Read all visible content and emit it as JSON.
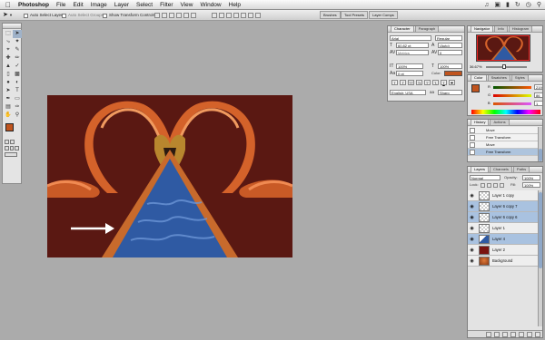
{
  "menubar": {
    "apple": "",
    "items": [
      "Photoshop",
      "File",
      "Edit",
      "Image",
      "Layer",
      "Select",
      "Filter",
      "View",
      "Window",
      "Help"
    ]
  },
  "options": {
    "auto_select_layer": "Auto Select Layer",
    "auto_select_groups": "Auto Select Groups",
    "show_transform_controls": "Show Transform Controls",
    "well_tabs": [
      "Brushes",
      "Tool Presets",
      "Layer Comps"
    ]
  },
  "character": {
    "tabs": [
      "Character",
      "Paragraph"
    ],
    "font_family": "Arial",
    "font_style": "Regular",
    "font_size": "60.82 pt",
    "leading": "(Auto)",
    "kerning": "Metrics",
    "tracking": "0",
    "vertical_scale": "100%",
    "horizontal_scale": "100%",
    "baseline_shift": "0 pt",
    "color_label": "Color:",
    "color_value": "#c0541e",
    "style_buttons": [
      "T",
      "T",
      "TT",
      "Tt",
      "T'",
      "T,",
      "T",
      "T"
    ],
    "language": "English: USA",
    "antialias_label": "aa",
    "antialias": "Sharp"
  },
  "navigator": {
    "tabs": [
      "Navigator",
      "Info",
      "Histogram"
    ],
    "zoom": "36.67%"
  },
  "color_panel": {
    "tabs": [
      "Color",
      "Swatches",
      "Styles"
    ],
    "channels": [
      {
        "label": "R",
        "value": "219"
      },
      {
        "label": "G",
        "value": "86"
      },
      {
        "label": "B",
        "value": "1"
      }
    ]
  },
  "history": {
    "tabs": [
      "History",
      "Actions"
    ],
    "items": [
      "Move",
      "Free Transform",
      "Move",
      "Free Transform"
    ]
  },
  "layers": {
    "tabs": [
      "Layers",
      "Channels",
      "Paths"
    ],
    "blend_mode": "Normal",
    "opacity_label": "Opacity:",
    "opacity": "100%",
    "lock_label": "Lock:",
    "fill_label": "Fill:",
    "fill": "100%",
    "items": [
      {
        "name": "Layer 1 copy",
        "thumb": "checker"
      },
      {
        "name": "Layer 6 copy 7",
        "thumb": "checker"
      },
      {
        "name": "Layer 6 copy 6",
        "thumb": "checker"
      },
      {
        "name": "Layer 1",
        "thumb": "checker"
      },
      {
        "name": "Layer 4",
        "thumb": "blue"
      },
      {
        "name": "Layer 2",
        "thumb": "red"
      },
      {
        "name": "Background",
        "thumb": "flamingo"
      }
    ]
  },
  "toolbox": {
    "foreground": "#c0541e",
    "background": "#ffffff",
    "tool_icons": [
      "move-tool",
      "marquee-tool",
      "lasso-tool",
      "magic-wand-tool",
      "crop-tool",
      "slice-tool",
      "healing-tool",
      "brush-tool",
      "stamp-tool",
      "history-brush-tool",
      "eraser-tool",
      "gradient-tool",
      "blur-tool",
      "dodge-tool",
      "path-select-tool",
      "type-tool",
      "pen-tool",
      "shape-tool",
      "notes-tool",
      "eyedropper-tool",
      "hand-tool",
      "zoom-tool"
    ]
  },
  "canvas": {
    "background": "#5a1812",
    "water": "#2f5aa3",
    "flamingo": "#d4622a",
    "arrow": "#ffffff"
  }
}
